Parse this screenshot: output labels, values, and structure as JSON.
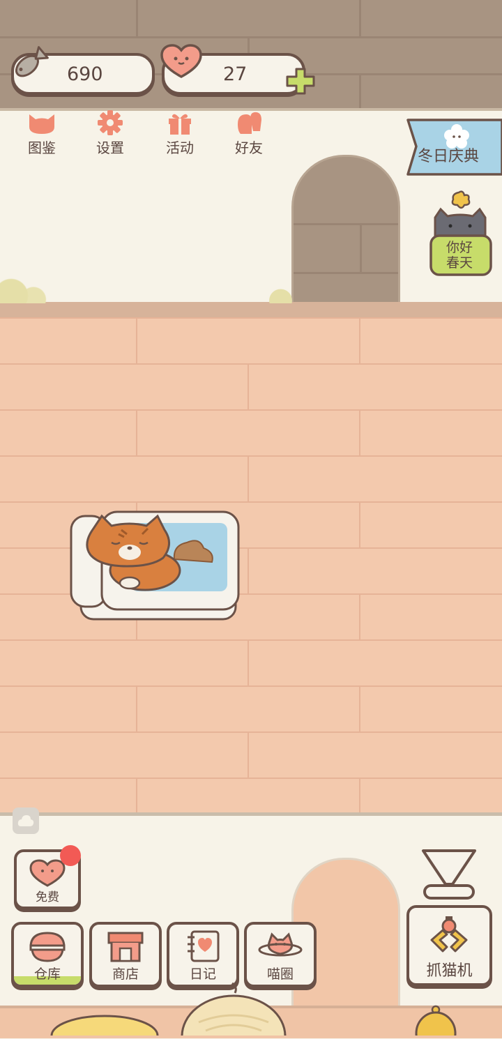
{
  "resources": {
    "fish": {
      "value": "690",
      "icon": "fish-icon"
    },
    "hearts": {
      "value": "27",
      "icon": "heart-face-icon",
      "add_icon": "plus-icon"
    }
  },
  "top_menu": [
    {
      "label": "图鉴",
      "icon": "cat-head-icon"
    },
    {
      "label": "设置",
      "icon": "gear-icon"
    },
    {
      "label": "活动",
      "icon": "gift-icon"
    },
    {
      "label": "好友",
      "icon": "friends-icon"
    }
  ],
  "events": {
    "winter": {
      "label": "冬日庆典",
      "icon": "flower-icon"
    },
    "spring": {
      "line1": "你好",
      "line2": "春天",
      "icon": "cat-sign-icon"
    }
  },
  "bottom_menu": {
    "free": {
      "label": "免费",
      "icon": "heart-icon",
      "badge": true
    },
    "warehouse": {
      "label": "仓库",
      "icon": "basket-icon"
    },
    "shop": {
      "label": "商店",
      "icon": "shop-icon"
    },
    "diary": {
      "label": "日记",
      "icon": "diary-icon"
    },
    "circle": {
      "label": "喵圈",
      "icon": "planet-cat-icon"
    },
    "claw": {
      "label": "抓猫机",
      "icon": "claw-icon"
    }
  },
  "colors": {
    "accent": "#f08a72",
    "outline": "#6b5248",
    "wall": "#a89482",
    "floor": "#f3c9ad",
    "badge": "#f25a55",
    "banner": "#a9d3e6",
    "green": "#c7dc6a"
  }
}
